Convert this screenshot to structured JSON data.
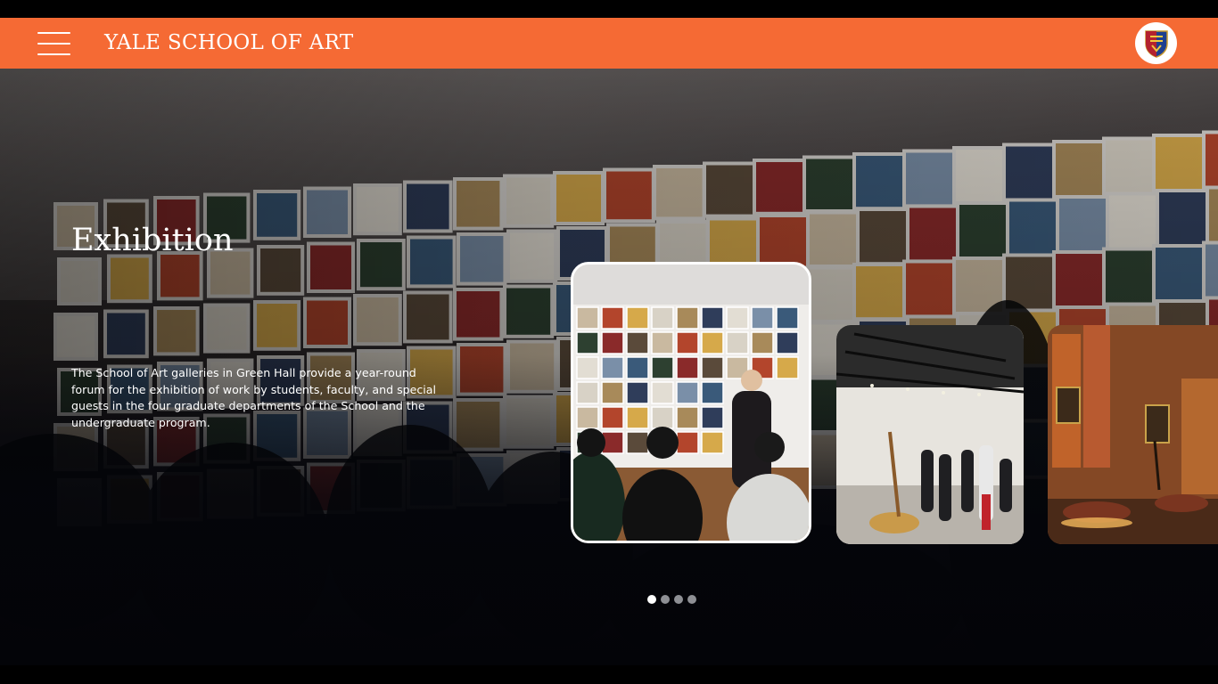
{
  "header": {
    "brand": "YALE SCHOOL OF ART",
    "menu_icon": "hamburger-menu-icon",
    "crest_icon": "yale-shield-crest-icon",
    "background": "#f56a34"
  },
  "hero": {
    "title": "Exhibition",
    "description": "The School of Art galleries in Green Hall provide a year-round forum for the exhibition of work by students, faculty, and special guests in the four graduate departments of the School and the undergraduate program."
  },
  "carousel": {
    "slides": [
      {
        "scene": "gallery-talk-photo",
        "selected": true
      },
      {
        "scene": "gallery-opening-crowd-photo",
        "selected": false
      },
      {
        "scene": "warm-lit-gallery-interior-photo",
        "selected": false
      }
    ],
    "page_count": 4,
    "active_page": 1
  },
  "colors": {
    "accent": "#f56a34",
    "text": "#ffffff",
    "dot_active": "#ffffff",
    "dot_inactive": "#8e8f94"
  }
}
